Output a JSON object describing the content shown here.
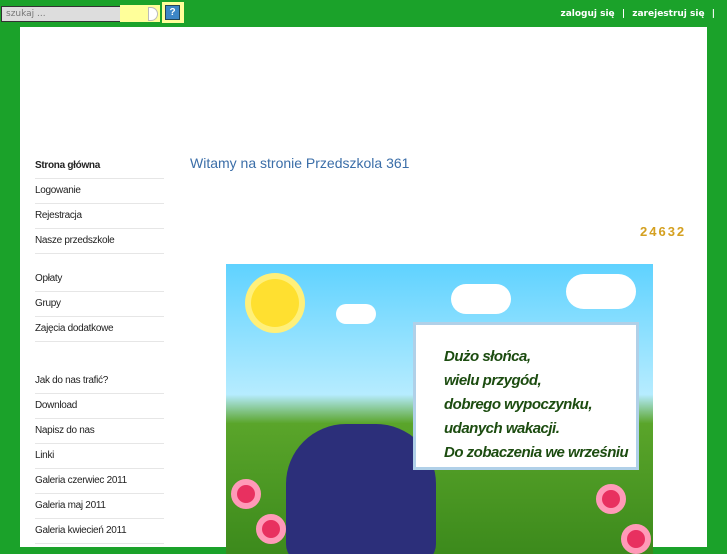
{
  "search": {
    "placeholder": "szukaj ..."
  },
  "help_label": "?",
  "top_links": [
    "zaloguj się",
    "zarejestruj się"
  ],
  "separator": "|",
  "menu": [
    {
      "label": "Strona główna",
      "active": true
    },
    {
      "label": "Logowanie"
    },
    {
      "label": "Rejestracja"
    },
    {
      "label": "Nasze przedszkole"
    },
    {
      "label": "Opłaty"
    },
    {
      "label": "Grupy"
    },
    {
      "label": "Zajęcia dodatkowe"
    },
    {
      "label": "Jak do nas trafić?"
    },
    {
      "label": "Download"
    },
    {
      "label": "Napisz do nas"
    },
    {
      "label": "Linki"
    },
    {
      "label": "Galeria czerwiec 2011"
    },
    {
      "label": "Galeria maj 2011"
    },
    {
      "label": "Galeria kwiecień 2011"
    }
  ],
  "page_title": "Witamy na stronie Przedszkola 361",
  "visit_counter": "24632",
  "banner_lines": [
    "Dużo słońca,",
    "wielu przygód,",
    "dobrego wypoczynku,",
    "udanych wakacji.",
    "Do zobaczenia we wrześniu"
  ]
}
